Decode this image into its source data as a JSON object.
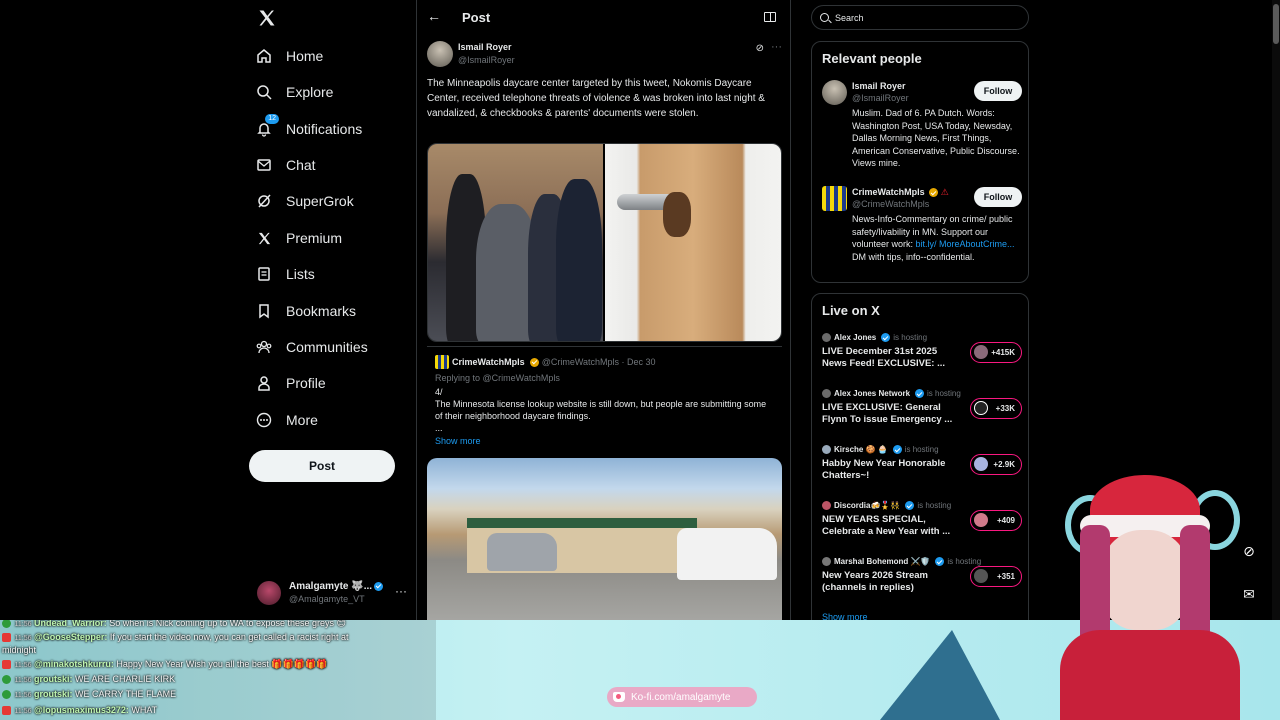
{
  "nav": {
    "items": [
      {
        "label": "Home",
        "icon": "home-icon"
      },
      {
        "label": "Explore",
        "icon": "search-icon"
      },
      {
        "label": "Notifications",
        "icon": "bell-icon",
        "badge": "12"
      },
      {
        "label": "Chat",
        "icon": "mail-icon"
      },
      {
        "label": "SuperGrok",
        "icon": "grok-icon"
      },
      {
        "label": "Premium",
        "icon": "x-logo-icon"
      },
      {
        "label": "Lists",
        "icon": "list-icon"
      },
      {
        "label": "Bookmarks",
        "icon": "bookmark-icon"
      },
      {
        "label": "Communities",
        "icon": "communities-icon"
      },
      {
        "label": "Profile",
        "icon": "person-icon"
      },
      {
        "label": "More",
        "icon": "more-circle-icon"
      }
    ],
    "post_button": "Post",
    "account": {
      "name": "Amalgamyte 🐺...",
      "handle": "@Amalgamyte_VT",
      "more": "···"
    }
  },
  "main": {
    "title": "Post",
    "post": {
      "author_name": "Ismail Royer",
      "author_handle": "@IsmailRoyer",
      "text": "The Minneapolis daycare center targeted by this tweet, Nokomis Daycare Center, received telephone threats of violence & was broken into last night & vandalized, & checkbooks & parents' documents were stolen."
    },
    "quote": {
      "name": "CrimeWatchMpls",
      "handle_date": "@CrimeWatchMpls · Dec 30",
      "replying": "Replying to @CrimeWatchMpls",
      "text": "4/\nThe Minnesota license lookup website is still down, but people are submitting some of their neighborhood daycare findings.\n...",
      "show_more": "Show more"
    }
  },
  "right": {
    "search_placeholder": "Search",
    "relevant_title": "Relevant people",
    "people": [
      {
        "name": "Ismail Royer",
        "handle": "@IsmailRoyer",
        "bio": "Muslim. Dad of 6. PA Dutch. Words: Washington Post, USA Today, Newsday, Dallas Morning News, First Things, American Conservative, Public Discourse. Views mine.",
        "follow": "Follow"
      },
      {
        "name": "CrimeWatchMpls",
        "handle": "@CrimeWatchMpls",
        "bio_a": "News-Info-Commentary on crime/ public safety/livability in MN. Support our volunteer work: ",
        "bio_link": "bit.ly/ MoreAboutCrime...",
        "bio_b": " DM with tips, info--confidential.",
        "follow": "Follow"
      }
    ],
    "live_title": "Live on X",
    "live": [
      {
        "host": "Alex Jones",
        "hosting": "is hosting",
        "title": "LIVE December 31st 2025 News Feed! EXCLUSIVE: ...",
        "count": "+415K"
      },
      {
        "host": "Alex Jones Network",
        "hosting": "is hosting",
        "title": "LIVE EXCLUSIVE: General Flynn To issue Emergency ...",
        "count": "+33K"
      },
      {
        "host": "Kirsche 🍪 🧁",
        "hosting": "is hosting",
        "title": "Habby New Year Honorable Chatters~!",
        "count": "+2.9K"
      },
      {
        "host": "Discordia🍻🎖️👯",
        "hosting": "is hosting",
        "title": "NEW YEARS SPECIAL, Celebrate a New Year with ...",
        "count": "+409"
      },
      {
        "host": "Marshal Bohemond ⚔️🛡️",
        "hosting": "is hosting",
        "title": "New Years 2026 Stream (channels in replies)",
        "count": "+351"
      }
    ],
    "show_more": "Show more"
  },
  "stream": {
    "chat": [
      {
        "platform": "kick",
        "time": "11:56",
        "user": "Undead_Warrior:",
        "msg": " So when is Nick coming up to WA to expose these greys 😊"
      },
      {
        "platform": "yt",
        "time": "11:56",
        "user": "@GooseStepper:",
        "msg": " If you start the video now, you can get called a racist right at"
      },
      {
        "platform": "cont",
        "time": "",
        "user": "",
        "msg": "midnight"
      },
      {
        "platform": "yt",
        "time": "11:56",
        "user": "@minakotshkurru:",
        "msg": " Happy New Year Wish you all the best 🎁🎁🎁🎁🎁"
      },
      {
        "platform": "kick",
        "time": "11:56",
        "user": "groutski:",
        "msg": " WE ARE CHARLIE KIRK"
      },
      {
        "platform": "kick",
        "time": "11:56",
        "user": "groutski:",
        "msg": " WE CARRY THE FLAME"
      },
      {
        "platform": "yt",
        "time": "11:56",
        "user": "@lopusmaximus3272:",
        "msg": " WHAT"
      }
    ],
    "kofi": "Ko-fi.com/amalgamyte"
  },
  "colors": {
    "accent": "#1d9bf0",
    "live_ring": "#f91880",
    "background": "#000000"
  }
}
